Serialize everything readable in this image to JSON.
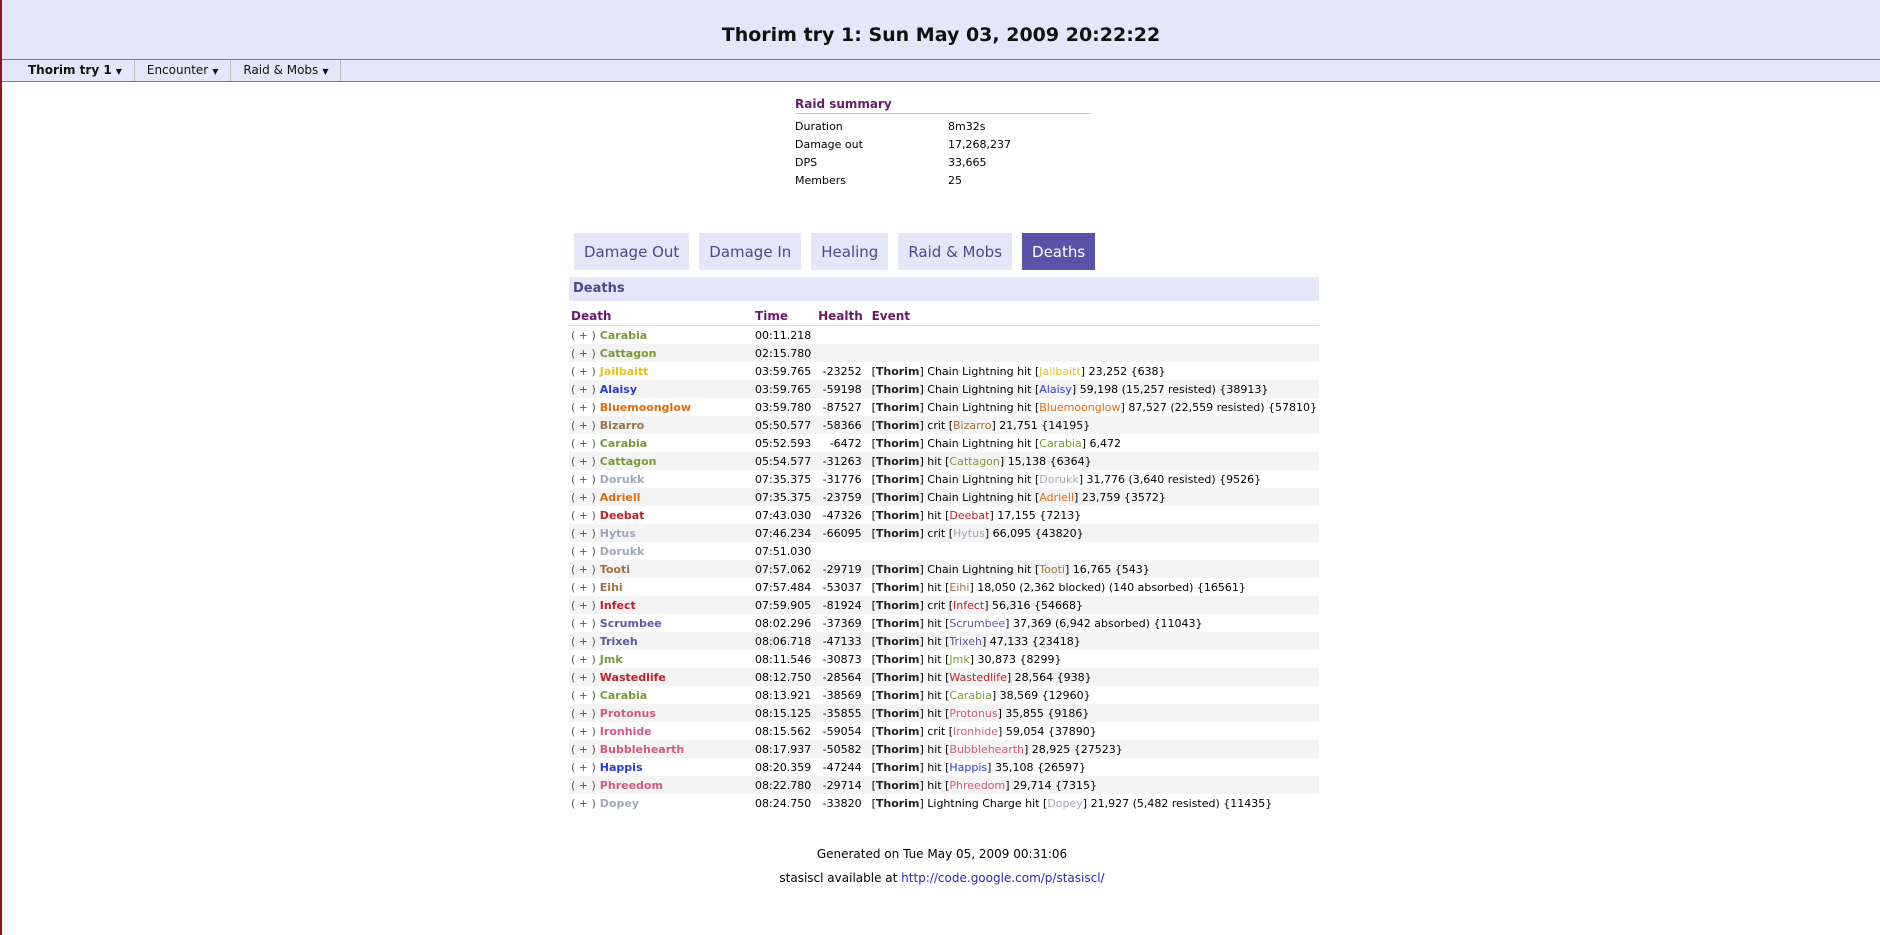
{
  "page": {
    "title": "Thorim try 1: Sun May 03, 2009 20:22:22"
  },
  "menu": [
    {
      "label": "Thorim try 1",
      "active": true
    },
    {
      "label": "Encounter",
      "active": false
    },
    {
      "label": "Raid & Mobs",
      "active": false
    }
  ],
  "summary": {
    "title": "Raid summary",
    "rows": [
      {
        "k": "Duration",
        "v": "8m32s"
      },
      {
        "k": "Damage out",
        "v": "17,268,237"
      },
      {
        "k": "DPS",
        "v": "33,665"
      },
      {
        "k": "Members",
        "v": "25"
      }
    ]
  },
  "tabs": [
    {
      "label": "Damage Out",
      "active": false
    },
    {
      "label": "Damage In",
      "active": false
    },
    {
      "label": "Healing",
      "active": false
    },
    {
      "label": "Raid & Mobs",
      "active": false
    },
    {
      "label": "Deaths",
      "active": true
    }
  ],
  "deaths": {
    "section_title": "Deaths",
    "columns": [
      "Death",
      "Time",
      "Health",
      "Event"
    ],
    "expand_label": "( + )",
    "source": "Thorim",
    "rows": [
      {
        "name": "Carabia",
        "color": "#7a9a3a",
        "time": "00:11.218",
        "health": "",
        "ev": []
      },
      {
        "name": "Cattagon",
        "color": "#7a9a3a",
        "time": "02:15.780",
        "health": "",
        "ev": []
      },
      {
        "name": "Jailbaitt",
        "color": "#e6c21a",
        "time": "03:59.765",
        "health": "-23252",
        "ev": [
          "Chain Lightning hit",
          "23,252 {638}"
        ]
      },
      {
        "name": "Alaisy",
        "color": "#2a3ad0",
        "time": "03:59.765",
        "health": "-59198",
        "ev": [
          "Chain Lightning hit",
          "59,198 (15,257 resisted) {38913}"
        ]
      },
      {
        "name": "Bluemoonglow",
        "color": "#e06a10",
        "time": "03:59.780",
        "health": "-87527",
        "ev": [
          "Chain Lightning hit",
          "87,527 (22,559 resisted) {57810}"
        ]
      },
      {
        "name": "Bizarro",
        "color": "#a07040",
        "time": "05:50.577",
        "health": "-58366",
        "ev": [
          "crit",
          "21,751 {14195}"
        ]
      },
      {
        "name": "Carabia",
        "color": "#7a9a3a",
        "time": "05:52.593",
        "health": "-6472",
        "ev": [
          "Chain Lightning hit",
          "6,472"
        ]
      },
      {
        "name": "Cattagon",
        "color": "#7a9a3a",
        "time": "05:54.577",
        "health": "-31263",
        "ev": [
          "hit",
          "15,138 {6364}"
        ]
      },
      {
        "name": "Dorukk",
        "color": "#a0a8b8",
        "time": "07:35.375",
        "health": "-31776",
        "ev": [
          "Chain Lightning hit",
          "31,776 (3,640 resisted) {9526}"
        ]
      },
      {
        "name": "Adriell",
        "color": "#e06a10",
        "time": "07:35.375",
        "health": "-23759",
        "ev": [
          "Chain Lightning hit",
          "23,759 {3572}"
        ]
      },
      {
        "name": "Deebat",
        "color": "#c0202a",
        "time": "07:43.030",
        "health": "-47326",
        "ev": [
          "hit",
          "17,155 {7213}"
        ]
      },
      {
        "name": "Hytus",
        "color": "#a0a8b8",
        "time": "07:46.234",
        "health": "-66095",
        "ev": [
          "crit",
          "66,095 {43820}"
        ]
      },
      {
        "name": "Dorukk",
        "color": "#a0a8b8",
        "time": "07:51.030",
        "health": "",
        "ev": []
      },
      {
        "name": "Tooti",
        "color": "#a07040",
        "time": "07:57.062",
        "health": "-29719",
        "ev": [
          "Chain Lightning hit",
          "16,765 {543}"
        ]
      },
      {
        "name": "Eihi",
        "color": "#a07040",
        "time": "07:57.484",
        "health": "-53037",
        "ev": [
          "hit",
          "18,050 (2,362 blocked) (140 absorbed) {16561}"
        ]
      },
      {
        "name": "Infect",
        "color": "#c0202a",
        "time": "07:59.905",
        "health": "-81924",
        "ev": [
          "crit",
          "56,316 {54668}"
        ]
      },
      {
        "name": "Scrumbee",
        "color": "#5a5aa0",
        "time": "08:02.296",
        "health": "-37369",
        "ev": [
          "hit",
          "37,369 (6,942 absorbed) {11043}"
        ]
      },
      {
        "name": "Trixeh",
        "color": "#5a5aa0",
        "time": "08:06.718",
        "health": "-47133",
        "ev": [
          "hit",
          "47,133 {23418}"
        ]
      },
      {
        "name": "Jmk",
        "color": "#7a9a3a",
        "time": "08:11.546",
        "health": "-30873",
        "ev": [
          "hit",
          "30,873 {8299}"
        ]
      },
      {
        "name": "Wastedlife",
        "color": "#c0202a",
        "time": "08:12.750",
        "health": "-28564",
        "ev": [
          "hit",
          "28,564 {938}"
        ]
      },
      {
        "name": "Carabia",
        "color": "#7a9a3a",
        "time": "08:13.921",
        "health": "-38569",
        "ev": [
          "hit",
          "38,569 {12960}"
        ]
      },
      {
        "name": "Protonus",
        "color": "#d05a80",
        "time": "08:15.125",
        "health": "-35855",
        "ev": [
          "hit",
          "35,855 {9186}"
        ]
      },
      {
        "name": "Ironhide",
        "color": "#d05a80",
        "time": "08:15.562",
        "health": "-59054",
        "ev": [
          "crit",
          "59,054 {37890}"
        ]
      },
      {
        "name": "Bubblehearth",
        "color": "#d05a80",
        "time": "08:17.937",
        "health": "-50582",
        "ev": [
          "hit",
          "28,925 {27523}"
        ]
      },
      {
        "name": "Happis",
        "color": "#2a3ad0",
        "time": "08:20.359",
        "health": "-47244",
        "ev": [
          "hit",
          "35,108 {26597}"
        ]
      },
      {
        "name": "Phreedom",
        "color": "#d05a80",
        "time": "08:22.780",
        "health": "-29714",
        "ev": [
          "hit",
          "29,714 {7315}"
        ]
      },
      {
        "name": "Dopey",
        "color": "#a0a8b8",
        "time": "08:24.750",
        "health": "-33820",
        "ev": [
          "Lightning Charge hit",
          "21,927 (5,482 resisted) {11435}"
        ]
      }
    ]
  },
  "footer": {
    "generated": "Generated on Tue May 05, 2009 00:31:06",
    "available_prefix": "stasiscl available at",
    "link": "http://code.google.com/p/stasiscl/"
  }
}
